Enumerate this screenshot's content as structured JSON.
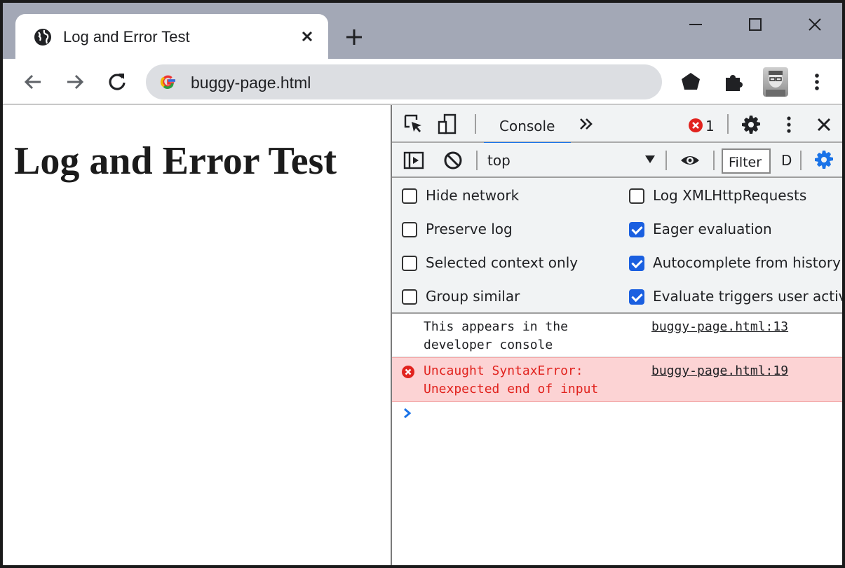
{
  "browser": {
    "tab_title": "Log and Error Test",
    "url": "buggy-page.html"
  },
  "page": {
    "heading": "Log and Error Test"
  },
  "devtools": {
    "active_tab": "Console",
    "error_count": "1",
    "context": "top",
    "filter_placeholder": "Filter",
    "cut_text": "D",
    "settings": {
      "left": [
        {
          "label": "Hide network",
          "checked": false
        },
        {
          "label": "Preserve log",
          "checked": false
        },
        {
          "label": "Selected context only",
          "checked": false
        },
        {
          "label": "Group similar",
          "checked": false
        }
      ],
      "right": [
        {
          "label": "Log XMLHttpRequests",
          "checked": false
        },
        {
          "label": "Eager evaluation",
          "checked": true
        },
        {
          "label": "Autocomplete from history",
          "checked": true
        },
        {
          "label": "Evaluate triggers user activa",
          "checked": true
        }
      ]
    },
    "messages": [
      {
        "type": "log",
        "text": "This appears in the\ndeveloper console",
        "source": "buggy-page.html:13"
      },
      {
        "type": "error",
        "text": "Uncaught SyntaxError:\nUnexpected end of input",
        "source": "buggy-page.html:19"
      }
    ],
    "colors": {
      "accent": "#1a73e8",
      "error_bg": "#fcd3d4",
      "error_text": "#e1231e",
      "checkbox": "#1a5fe0"
    }
  }
}
